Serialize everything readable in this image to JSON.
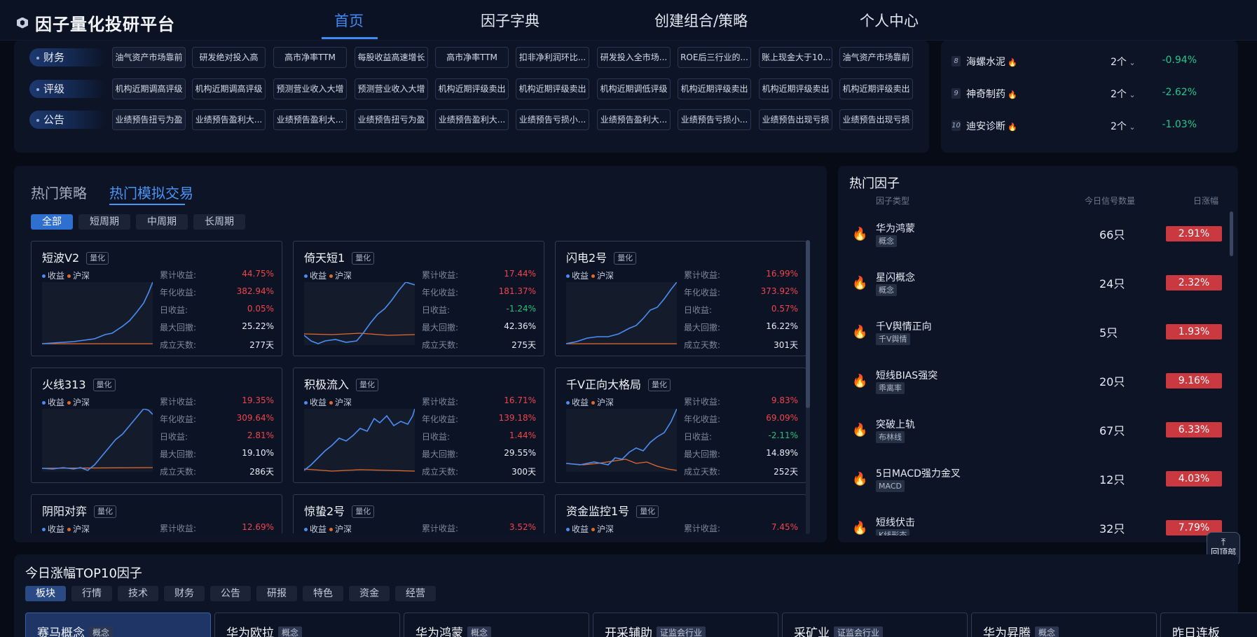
{
  "header": {
    "title": "因子量化投研平台",
    "nav": [
      "首页",
      "因子字典",
      "创建组合/策略",
      "个人中心"
    ],
    "active_nav": 0
  },
  "tag_rows": [
    {
      "label": "财务",
      "chips": [
        "油气资产市场靠前",
        "研发绝对投入高",
        "高市净率TTM",
        "每股收益高速增长",
        "高市净率TTM",
        "扣非净利润环比...",
        "研发投入全市场...",
        "ROE后三行业的...",
        "账上现金大于10...",
        "油气资产市场靠前"
      ]
    },
    {
      "label": "评级",
      "chips": [
        "机构近期调高评级",
        "机构近期调高评级",
        "预测营业收入大增",
        "预测营业收入大增",
        "机构近期评级卖出",
        "机构近期评级卖出",
        "机构近期调低评级",
        "机构近期评级卖出",
        "机构近期评级卖出",
        "机构近期评级卖出"
      ]
    },
    {
      "label": "公告",
      "chips": [
        "业绩预告扭亏为盈",
        "业绩预告盈利大...",
        "业绩预告盈利大...",
        "业绩预告扭亏为盈",
        "业绩预告盈利大...",
        "业绩预告亏损小...",
        "业绩预告盈利大...",
        "业绩预告亏损小...",
        "业绩预告出现亏损",
        "业绩预告出现亏损"
      ]
    }
  ],
  "rank_list": [
    {
      "no": "8",
      "name": "海螺水泥",
      "count": "2个",
      "change": "-0.94%"
    },
    {
      "no": "9",
      "name": "神奇制药",
      "count": "2个",
      "change": "-2.62%"
    },
    {
      "no": "10",
      "name": "迪安诊断",
      "count": "2个",
      "change": "-1.03%"
    }
  ],
  "strategy": {
    "tabs": [
      "热门策略",
      "热门模拟交易"
    ],
    "active_tab": 1,
    "filters": [
      "全部",
      "短周期",
      "中周期",
      "长周期"
    ],
    "active_filter": 0,
    "legend": {
      "a": "收益",
      "b": "沪深"
    },
    "stat_labels": [
      "累计收益:",
      "年化收益:",
      "日收益:",
      "最大回撤:",
      "成立天数:"
    ],
    "cards": [
      {
        "name": "短波V2",
        "badge": "量化",
        "stats": [
          "44.75%",
          "382.94%",
          "0.05%",
          "25.22%",
          "277天"
        ],
        "dirs": [
          "up",
          "up",
          "up",
          "",
          ""
        ]
      },
      {
        "name": "倚天短1",
        "badge": "量化",
        "stats": [
          "17.44%",
          "181.37%",
          "-1.24%",
          "42.36%",
          "275天"
        ],
        "dirs": [
          "up",
          "up",
          "down",
          "",
          ""
        ]
      },
      {
        "name": "闪电2号",
        "badge": "量化",
        "stats": [
          "16.99%",
          "373.92%",
          "0.57%",
          "16.22%",
          "301天"
        ],
        "dirs": [
          "up",
          "up",
          "up",
          "",
          ""
        ]
      },
      {
        "name": "火线313",
        "badge": "量化",
        "stats": [
          "19.35%",
          "309.64%",
          "2.81%",
          "19.10%",
          "286天"
        ],
        "dirs": [
          "up",
          "up",
          "up",
          "",
          ""
        ]
      },
      {
        "name": "积极流入",
        "badge": "量化",
        "stats": [
          "16.71%",
          "139.18%",
          "1.44%",
          "29.55%",
          "300天"
        ],
        "dirs": [
          "up",
          "up",
          "up",
          "",
          ""
        ]
      },
      {
        "name": "千V正向大格局",
        "badge": "量化",
        "stats": [
          "9.83%",
          "69.09%",
          "-2.11%",
          "14.89%",
          "252天"
        ],
        "dirs": [
          "up",
          "up",
          "down",
          "",
          ""
        ]
      },
      {
        "name": "阴阳对弈",
        "badge": "量化",
        "stats": [
          "12.69%",
          "",
          "",
          "",
          ""
        ],
        "dirs": [
          "up",
          "",
          "",
          "",
          ""
        ]
      },
      {
        "name": "惊蛰2号",
        "badge": "量化",
        "stats": [
          "3.52%",
          "",
          "",
          "",
          ""
        ],
        "dirs": [
          "up",
          "",
          "",
          "",
          ""
        ]
      },
      {
        "name": "资金监控1号",
        "badge": "量化",
        "stats": [
          "7.45%",
          "",
          "",
          "",
          ""
        ],
        "dirs": [
          "up",
          "",
          "",
          "",
          ""
        ]
      }
    ]
  },
  "hot_factors": {
    "title": "热门因子",
    "headers": [
      "因子类型",
      "今日信号数量",
      "日涨幅"
    ],
    "rows": [
      {
        "name": "华为鸿蒙",
        "tag": "概念",
        "count": "66只",
        "change": "2.91%"
      },
      {
        "name": "星闪概念",
        "tag": "概念",
        "count": "24只",
        "change": "2.32%"
      },
      {
        "name": "千V舆情正向",
        "tag": "千V舆情",
        "count": "5只",
        "change": "1.93%"
      },
      {
        "name": "短线BIAS强突",
        "tag": "乖离率",
        "count": "20只",
        "change": "9.16%"
      },
      {
        "name": "突破上轨",
        "tag": "布林线",
        "count": "67只",
        "change": "6.33%"
      },
      {
        "name": "5日MACD强力金叉",
        "tag": "MACD",
        "count": "12只",
        "change": "4.03%"
      },
      {
        "name": "短线伏击",
        "tag": "K线形态",
        "count": "32只",
        "change": "7.79%"
      }
    ]
  },
  "back_top": {
    "label": "回顶部"
  },
  "top10": {
    "title": "今日涨幅TOP10因子",
    "categories": [
      "板块",
      "行情",
      "技术",
      "财务",
      "公告",
      "研报",
      "特色",
      "资金",
      "经营"
    ],
    "active_category": 0,
    "cards": [
      {
        "name": "赛马概念",
        "tag": "概念"
      },
      {
        "name": "华为欧拉",
        "tag": "概念"
      },
      {
        "name": "华为鸿蒙",
        "tag": "概念"
      },
      {
        "name": "开采辅助",
        "tag": "证监会行业"
      },
      {
        "name": "采矿业",
        "tag": "证监会行业"
      },
      {
        "name": "华为昇腾",
        "tag": "概念"
      },
      {
        "name": "昨日连板",
        "tag": ""
      }
    ]
  },
  "colors": {
    "accent": "#3f8cf5",
    "up": "#f0454c",
    "down": "#1ec37c",
    "series_a": "#4a8df5",
    "series_b": "#e06a2c"
  }
}
